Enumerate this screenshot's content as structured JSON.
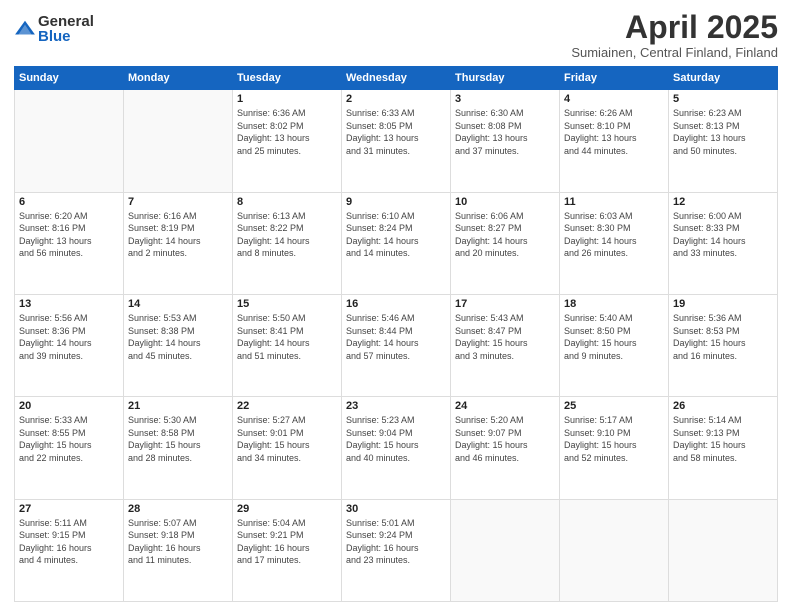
{
  "header": {
    "logo_general": "General",
    "logo_blue": "Blue",
    "title": "April 2025",
    "location": "Sumiainen, Central Finland, Finland"
  },
  "weekdays": [
    "Sunday",
    "Monday",
    "Tuesday",
    "Wednesday",
    "Thursday",
    "Friday",
    "Saturday"
  ],
  "weeks": [
    [
      {
        "day": "",
        "info": ""
      },
      {
        "day": "",
        "info": ""
      },
      {
        "day": "1",
        "info": "Sunrise: 6:36 AM\nSunset: 8:02 PM\nDaylight: 13 hours\nand 25 minutes."
      },
      {
        "day": "2",
        "info": "Sunrise: 6:33 AM\nSunset: 8:05 PM\nDaylight: 13 hours\nand 31 minutes."
      },
      {
        "day": "3",
        "info": "Sunrise: 6:30 AM\nSunset: 8:08 PM\nDaylight: 13 hours\nand 37 minutes."
      },
      {
        "day": "4",
        "info": "Sunrise: 6:26 AM\nSunset: 8:10 PM\nDaylight: 13 hours\nand 44 minutes."
      },
      {
        "day": "5",
        "info": "Sunrise: 6:23 AM\nSunset: 8:13 PM\nDaylight: 13 hours\nand 50 minutes."
      }
    ],
    [
      {
        "day": "6",
        "info": "Sunrise: 6:20 AM\nSunset: 8:16 PM\nDaylight: 13 hours\nand 56 minutes."
      },
      {
        "day": "7",
        "info": "Sunrise: 6:16 AM\nSunset: 8:19 PM\nDaylight: 14 hours\nand 2 minutes."
      },
      {
        "day": "8",
        "info": "Sunrise: 6:13 AM\nSunset: 8:22 PM\nDaylight: 14 hours\nand 8 minutes."
      },
      {
        "day": "9",
        "info": "Sunrise: 6:10 AM\nSunset: 8:24 PM\nDaylight: 14 hours\nand 14 minutes."
      },
      {
        "day": "10",
        "info": "Sunrise: 6:06 AM\nSunset: 8:27 PM\nDaylight: 14 hours\nand 20 minutes."
      },
      {
        "day": "11",
        "info": "Sunrise: 6:03 AM\nSunset: 8:30 PM\nDaylight: 14 hours\nand 26 minutes."
      },
      {
        "day": "12",
        "info": "Sunrise: 6:00 AM\nSunset: 8:33 PM\nDaylight: 14 hours\nand 33 minutes."
      }
    ],
    [
      {
        "day": "13",
        "info": "Sunrise: 5:56 AM\nSunset: 8:36 PM\nDaylight: 14 hours\nand 39 minutes."
      },
      {
        "day": "14",
        "info": "Sunrise: 5:53 AM\nSunset: 8:38 PM\nDaylight: 14 hours\nand 45 minutes."
      },
      {
        "day": "15",
        "info": "Sunrise: 5:50 AM\nSunset: 8:41 PM\nDaylight: 14 hours\nand 51 minutes."
      },
      {
        "day": "16",
        "info": "Sunrise: 5:46 AM\nSunset: 8:44 PM\nDaylight: 14 hours\nand 57 minutes."
      },
      {
        "day": "17",
        "info": "Sunrise: 5:43 AM\nSunset: 8:47 PM\nDaylight: 15 hours\nand 3 minutes."
      },
      {
        "day": "18",
        "info": "Sunrise: 5:40 AM\nSunset: 8:50 PM\nDaylight: 15 hours\nand 9 minutes."
      },
      {
        "day": "19",
        "info": "Sunrise: 5:36 AM\nSunset: 8:53 PM\nDaylight: 15 hours\nand 16 minutes."
      }
    ],
    [
      {
        "day": "20",
        "info": "Sunrise: 5:33 AM\nSunset: 8:55 PM\nDaylight: 15 hours\nand 22 minutes."
      },
      {
        "day": "21",
        "info": "Sunrise: 5:30 AM\nSunset: 8:58 PM\nDaylight: 15 hours\nand 28 minutes."
      },
      {
        "day": "22",
        "info": "Sunrise: 5:27 AM\nSunset: 9:01 PM\nDaylight: 15 hours\nand 34 minutes."
      },
      {
        "day": "23",
        "info": "Sunrise: 5:23 AM\nSunset: 9:04 PM\nDaylight: 15 hours\nand 40 minutes."
      },
      {
        "day": "24",
        "info": "Sunrise: 5:20 AM\nSunset: 9:07 PM\nDaylight: 15 hours\nand 46 minutes."
      },
      {
        "day": "25",
        "info": "Sunrise: 5:17 AM\nSunset: 9:10 PM\nDaylight: 15 hours\nand 52 minutes."
      },
      {
        "day": "26",
        "info": "Sunrise: 5:14 AM\nSunset: 9:13 PM\nDaylight: 15 hours\nand 58 minutes."
      }
    ],
    [
      {
        "day": "27",
        "info": "Sunrise: 5:11 AM\nSunset: 9:15 PM\nDaylight: 16 hours\nand 4 minutes."
      },
      {
        "day": "28",
        "info": "Sunrise: 5:07 AM\nSunset: 9:18 PM\nDaylight: 16 hours\nand 11 minutes."
      },
      {
        "day": "29",
        "info": "Sunrise: 5:04 AM\nSunset: 9:21 PM\nDaylight: 16 hours\nand 17 minutes."
      },
      {
        "day": "30",
        "info": "Sunrise: 5:01 AM\nSunset: 9:24 PM\nDaylight: 16 hours\nand 23 minutes."
      },
      {
        "day": "",
        "info": ""
      },
      {
        "day": "",
        "info": ""
      },
      {
        "day": "",
        "info": ""
      }
    ]
  ]
}
